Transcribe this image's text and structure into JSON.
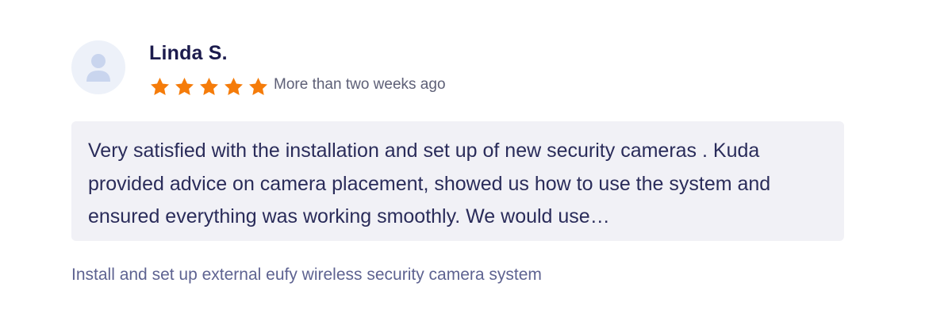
{
  "review": {
    "author": "Linda S.",
    "rating": 5,
    "rating_max": 5,
    "date": "More than two weeks ago",
    "text": "Very satisfied with the installation and set up of new security cameras . Kuda provided advice on camera placement, showed us how to use the system and ensured everything was working smoothly. We would use…",
    "job_title": "Install and set up external eufy wireless security camera system"
  },
  "icons": {
    "avatar": "user-silhouette-icon",
    "star": "star-icon"
  },
  "colors": {
    "star": "#f57c0a",
    "author": "#1c1b4d",
    "quote_background": "#f1f1f6",
    "avatar_background": "#edf1f9",
    "avatar_icon": "#c9d5ee"
  }
}
